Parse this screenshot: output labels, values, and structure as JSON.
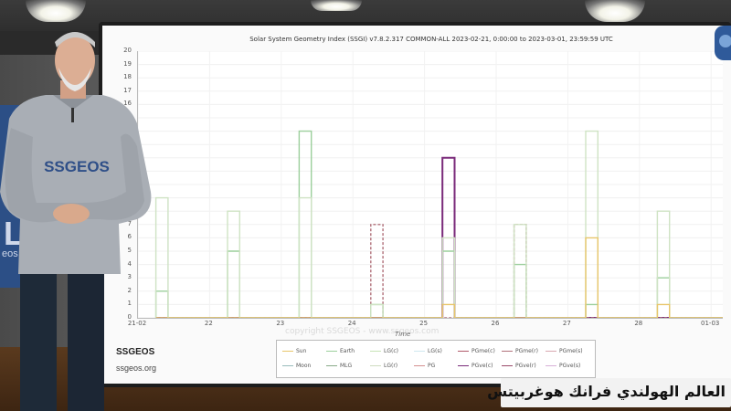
{
  "chart": {
    "title": "Solar System Geometry Index (SSGI) v7.8.2.317 COMMON-ALL 2023-02-21,  0:00:00 to 2023-03-01, 23:59:59 UTC",
    "xlabel": "Time",
    "y_ticks": [
      "0",
      "1",
      "2",
      "3",
      "4",
      "5",
      "6",
      "7",
      "8",
      "9",
      "10",
      "11",
      "12",
      "13",
      "14",
      "15",
      "16",
      "17",
      "18",
      "19",
      "20"
    ],
    "x_ticks": [
      "21-02",
      "22",
      "23",
      "24",
      "25",
      "26",
      "27",
      "28",
      "01-03"
    ],
    "legend": {
      "items": [
        "Sun",
        "Earth",
        "LG(c)",
        "LG(s)",
        "PGme(c)",
        "PGme(r)",
        "PGme(s)",
        "Moon",
        "MLG",
        "LG(r)",
        "PG",
        "PGve(c)",
        "PGve(r)",
        "PGve(s)"
      ],
      "colors": [
        "#e8c66a",
        "#9ccf9c",
        "#c7e3b7",
        "#cfe8f0",
        "#b05a6a",
        "#b0707a",
        "#d8a8b0",
        "#9bb",
        "#8a8",
        "#cfdcc0",
        "#d49090",
        "#7a2a7a",
        "#9a4a6a",
        "#d8b0d8"
      ]
    },
    "watermark": "copyright SSGEOS - www.ssgeos.com"
  },
  "chart_data": {
    "type": "line",
    "x": [
      "21-02",
      "22",
      "23",
      "24",
      "25",
      "26",
      "27",
      "28",
      "01-03"
    ],
    "ylim": [
      0,
      20
    ],
    "series": [
      {
        "name": "PGve(c)",
        "values": [
          0,
          0,
          0,
          0,
          12,
          0,
          0,
          0,
          8
        ]
      },
      {
        "name": "PGme(r)",
        "values": [
          0,
          0,
          0,
          7,
          0,
          7,
          0,
          0,
          0
        ]
      },
      {
        "name": "Earth",
        "values": [
          2,
          5,
          14,
          1,
          5,
          4,
          1,
          3,
          1
        ]
      },
      {
        "name": "LG(c)",
        "values": [
          9,
          8,
          9,
          1,
          6,
          7,
          14,
          8,
          1
        ]
      },
      {
        "name": "Sun",
        "values": [
          0,
          0,
          0,
          0,
          1,
          0,
          6,
          1,
          0
        ]
      }
    ]
  },
  "brand": {
    "name": "SSGEOS",
    "url": "ssgeos.org",
    "shirt_text": "SSGEOS",
    "back_letters": "L",
    "back_sub": "eos"
  },
  "caption": {
    "text": "العالم الهولندي فرانك هوغربيتس"
  }
}
